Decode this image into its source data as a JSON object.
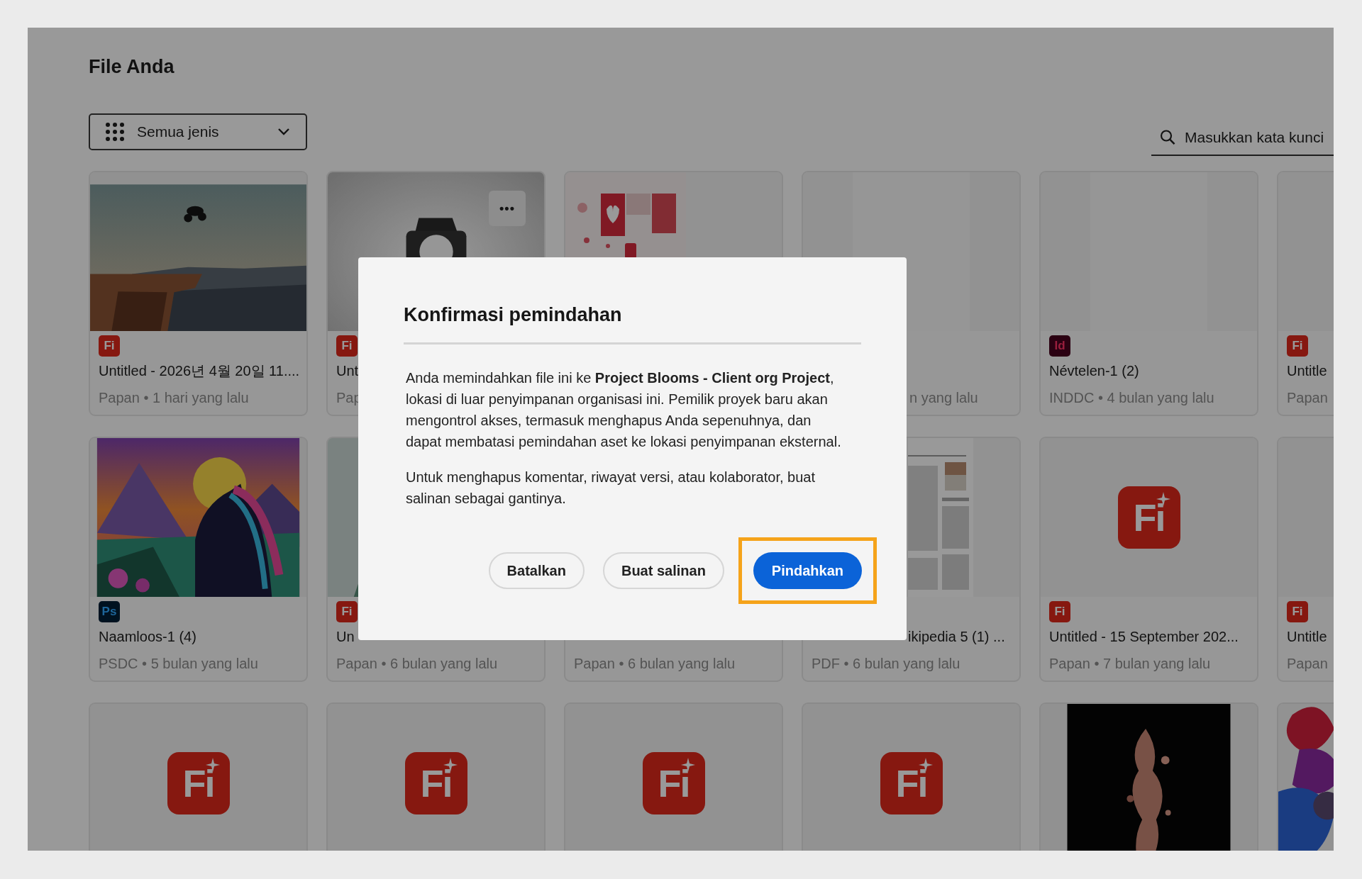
{
  "page": {
    "title": "File Anda"
  },
  "filter": {
    "label": "Semua jenis"
  },
  "search": {
    "placeholder": "Masukkan kata kunci"
  },
  "file_grid": {
    "rows": [
      {
        "cards": [
          {
            "thumbnail": {
              "kind": "picture"
            },
            "badge": {
              "kind": "fi",
              "text": "Fi"
            },
            "title": "Untitled - 2026년 4월 20일 11....",
            "meta": "Papan • 1 hari yang lalu"
          },
          {
            "thumbnail": {
              "kind": "picture"
            },
            "more_button": "•••",
            "badge": {
              "kind": "fi",
              "text": "Fi"
            },
            "title": "Unt",
            "meta": "Pap"
          },
          {
            "thumbnail": {
              "kind": "picture"
            }
          },
          {
            "thumbnail": {
              "kind": "page"
            },
            "meta": "n yang lalu"
          },
          {
            "thumbnail": {
              "kind": "page"
            },
            "badge": {
              "kind": "id",
              "text": "Id"
            },
            "title": "Névtelen-1 (2)",
            "meta": "INDDC • 4 bulan yang lalu"
          },
          {
            "badge": {
              "kind": "fi",
              "text": "Fi"
            },
            "title": "Untitle",
            "meta": "Papan"
          }
        ]
      },
      {
        "cards": [
          {
            "thumbnail": {
              "kind": "picture"
            },
            "badge": {
              "kind": "ps",
              "text": "Ps"
            },
            "title": "Naamloos-1 (4)",
            "meta": "PSDC • 5 bulan yang lalu"
          },
          {
            "thumbnail": {
              "kind": "picture"
            },
            "badge": {
              "kind": "fi",
              "text": "Fi"
            },
            "title": "Un",
            "meta": "Papan • 6 bulan yang lalu"
          },
          {
            "meta": "Papan • 6 bulan yang lalu"
          },
          {
            "thumbnail": {
              "kind": "picture"
            },
            "title": "ikipedia 5 (1) ...",
            "meta": "PDF • 6 bulan yang lalu"
          },
          {
            "thumbnail": {
              "kind": "logo",
              "text": "Fi"
            },
            "badge": {
              "kind": "fi",
              "text": "Fi"
            },
            "title": "Untitled - 15 September 202...",
            "meta": "Papan • 7 bulan yang lalu"
          },
          {
            "badge": {
              "kind": "fi",
              "text": "Fi"
            },
            "title": "Untitle",
            "meta": "Papan"
          }
        ]
      },
      {
        "cards": [
          {
            "thumbnail": {
              "kind": "logo",
              "text": "Fi"
            }
          },
          {
            "thumbnail": {
              "kind": "logo",
              "text": "Fi"
            }
          },
          {
            "thumbnail": {
              "kind": "logo",
              "text": "Fi"
            }
          },
          {
            "thumbnail": {
              "kind": "logo",
              "text": "Fi"
            }
          },
          {
            "thumbnail": {
              "kind": "picture"
            }
          },
          {
            "thumbnail": {
              "kind": "picture"
            }
          }
        ]
      }
    ]
  },
  "dialog": {
    "title": "Konfirmasi pemindahan",
    "paragraphs": [
      "Anda memindahkan file ini ke **Project Blooms - Client org Project**, lokasi di luar penyimpanan organisasi ini. Pemilik proyek baru akan mengontrol akses, termasuk menghapus Anda sepenuhnya, dan dapat membatasi pemindahan aset ke lokasi penyimpanan eksternal.",
      "Untuk menghapus komentar, riwayat versi, atau kolaborator, buat salinan sebagai gantinya."
    ],
    "buttons": [
      {
        "label": "Batalkan",
        "kind": "secondary",
        "focused": false
      },
      {
        "label": "Buat salinan",
        "kind": "secondary",
        "focused": false
      },
      {
        "label": "Pindahkan",
        "kind": "primary",
        "focused": true
      }
    ]
  }
}
